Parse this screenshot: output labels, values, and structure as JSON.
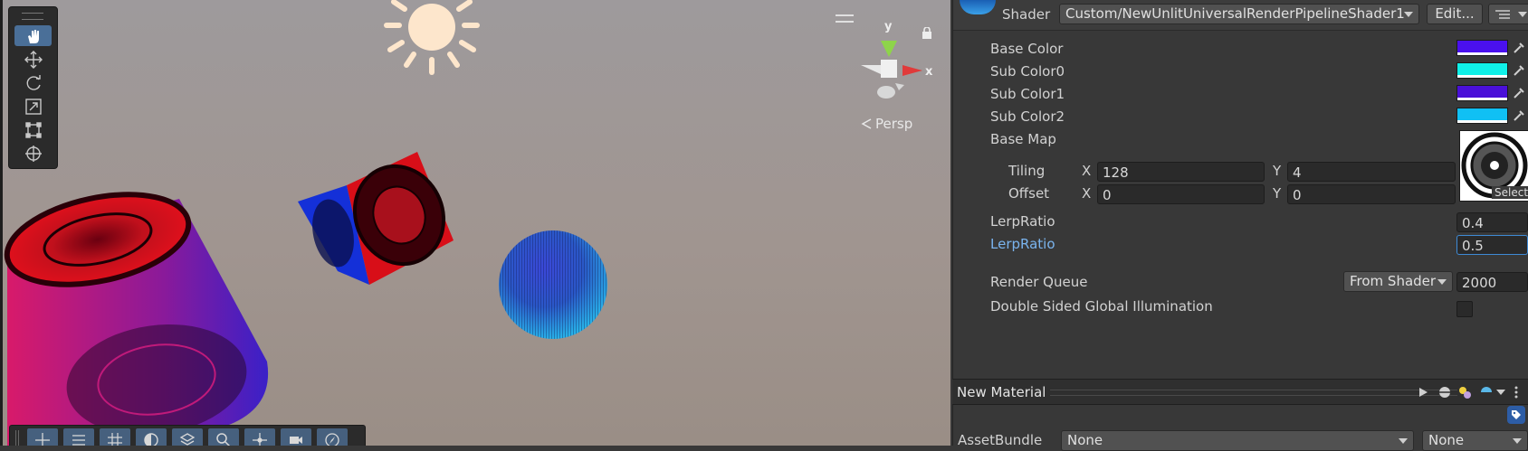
{
  "scene": {
    "persp_label": "Persp",
    "gizmo_y": "y",
    "gizmo_x": "x",
    "tools": [
      "hand-tool",
      "move-tool",
      "rotate-tool",
      "scale-tool",
      "rect-tool",
      "transform-tool"
    ],
    "active_tool": "hand-tool",
    "bottom_tools": [
      "center-pivot-icon",
      "snap-settings-icon",
      "grid-icon",
      "lighting-icon",
      "layers-icon",
      "search-icon",
      "gizmo-icon",
      "camera-icon",
      "navigation-icon"
    ]
  },
  "inspector": {
    "shader_label": "Shader",
    "shader_value": "Custom/NewUnlitUniversalRenderPipelineShader1",
    "edit_button": "Edit...",
    "properties": [
      {
        "label": "Base Color",
        "color": "#4a10ee"
      },
      {
        "label": "Sub Color0",
        "color": "#10f0e8"
      },
      {
        "label": "Sub Color1",
        "color": "#4a10d8"
      },
      {
        "label": "Sub Color2",
        "color": "#10c0f4"
      }
    ],
    "base_map_label": "Base Map",
    "tiling_label": "Tiling",
    "offset_label": "Offset",
    "axis_x": "X",
    "axis_y": "Y",
    "tiling_x": "128",
    "tiling_y": "4",
    "offset_x": "0",
    "offset_y": "0",
    "select_label": "Select",
    "lerp1_label": "LerpRatio",
    "lerp1_value": "0.4",
    "lerp2_label": "LerpRatio",
    "lerp2_value": "0.5",
    "render_queue_label": "Render Queue",
    "render_queue_mode": "From Shader",
    "render_queue_value": "2000",
    "dsgi_label": "Double Sided Global Illumination",
    "preview_title": "New Material",
    "assetbundle_label": "AssetBundle",
    "assetbundle_value": "None",
    "assetbundle_variant": "None"
  },
  "colors": {
    "accent": "#4a6f98",
    "focus_blue": "#3e8ad6",
    "label_blue": "#7ab4ee"
  }
}
